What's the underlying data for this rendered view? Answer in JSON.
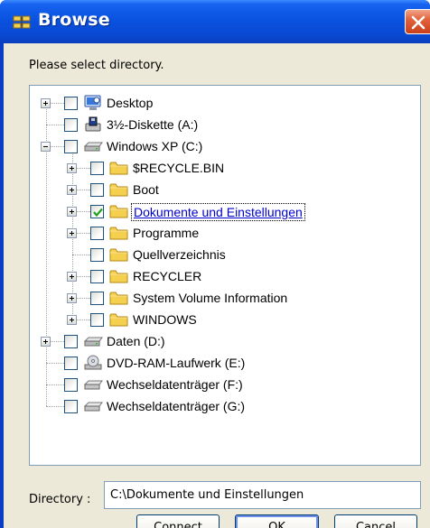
{
  "window": {
    "title": "Browse",
    "icon": "folder-browse-icon",
    "close_icon": "close-x-icon"
  },
  "prompt": "Please select directory.",
  "tree": {
    "nodes": [
      {
        "label": "Desktop",
        "icon": "desktop-icon",
        "expander": "plus",
        "checked": false
      },
      {
        "label": "3½-Diskette (A:)",
        "icon": "floppy-drive-icon",
        "expander": "none",
        "checked": false
      },
      {
        "label": "Windows XP (C:)",
        "icon": "hard-drive-icon",
        "expander": "minus",
        "checked": false
      },
      {
        "label": "$RECYCLE.BIN",
        "icon": "folder-icon",
        "expander": "plus",
        "checked": false
      },
      {
        "label": "Boot",
        "icon": "folder-icon",
        "expander": "plus",
        "checked": false
      },
      {
        "label": "Dokumente und Einstellungen",
        "icon": "folder-icon",
        "expander": "plus",
        "checked": true,
        "selected": true
      },
      {
        "label": "Programme",
        "icon": "folder-icon",
        "expander": "plus",
        "checked": false
      },
      {
        "label": "Quellverzeichnis",
        "icon": "folder-icon",
        "expander": "none",
        "checked": false
      },
      {
        "label": "RECYCLER",
        "icon": "folder-icon",
        "expander": "plus",
        "checked": false
      },
      {
        "label": "System Volume Information",
        "icon": "folder-icon",
        "expander": "plus",
        "checked": false
      },
      {
        "label": "WINDOWS",
        "icon": "folder-icon",
        "expander": "plus",
        "checked": false
      },
      {
        "label": "Daten (D:)",
        "icon": "hard-drive-icon",
        "expander": "plus",
        "checked": false
      },
      {
        "label": "DVD-RAM-Laufwerk (E:)",
        "icon": "dvd-drive-icon",
        "expander": "none",
        "checked": false
      },
      {
        "label": "Wechseldatenträger (F:)",
        "icon": "removable-drive-icon",
        "expander": "none",
        "checked": false
      },
      {
        "label": "Wechseldatenträger (G:)",
        "icon": "removable-drive-icon",
        "expander": "none",
        "checked": false
      }
    ]
  },
  "directory": {
    "label": "Directory :",
    "value": "C:\\Dokumente und Einstellungen"
  },
  "buttons": {
    "connect": {
      "prefix": "C",
      "rest": "onnect"
    },
    "ok": "OK",
    "cancel": "Cancel"
  },
  "colors": {
    "titlebar": "#0a52e0",
    "client": "#ece9d8",
    "selected_text": "#0000cc",
    "check": "#21a121",
    "folder": "#f5cf4e"
  }
}
